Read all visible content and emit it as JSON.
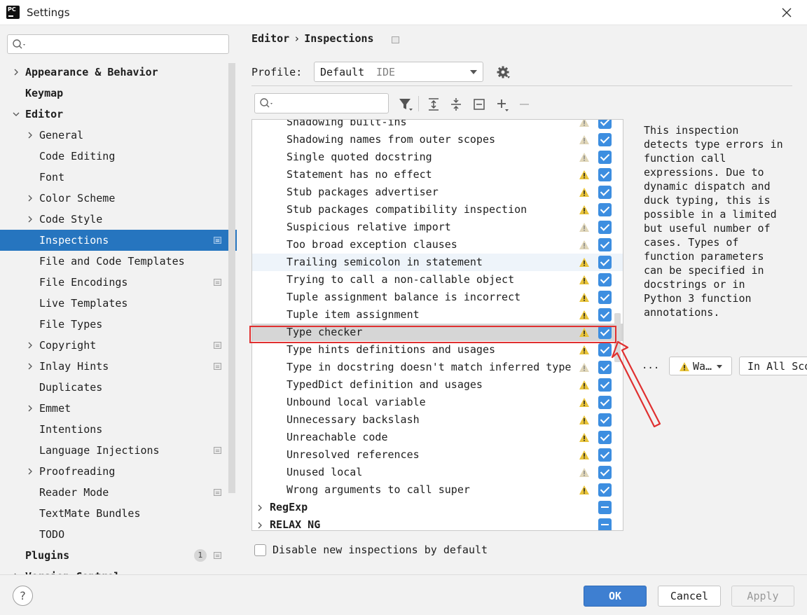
{
  "window": {
    "title": "Settings",
    "app_icon_text": "PC"
  },
  "search": {
    "placeholder": ""
  },
  "tree": [
    {
      "label": "Appearance & Behavior",
      "bold": true,
      "level": 0,
      "chevron": "right"
    },
    {
      "label": "Keymap",
      "bold": true,
      "level": 0,
      "chevron": "none"
    },
    {
      "label": "Editor",
      "bold": true,
      "level": 0,
      "chevron": "down"
    },
    {
      "label": "General",
      "level": 1,
      "chevron": "right"
    },
    {
      "label": "Code Editing",
      "level": 1,
      "chevron": "none"
    },
    {
      "label": "Font",
      "level": 1,
      "chevron": "none"
    },
    {
      "label": "Color Scheme",
      "level": 1,
      "chevron": "right"
    },
    {
      "label": "Code Style",
      "level": 1,
      "chevron": "right"
    },
    {
      "label": "Inspections",
      "level": 1,
      "chevron": "none",
      "selected": true,
      "badge": true
    },
    {
      "label": "File and Code Templates",
      "level": 1,
      "chevron": "none"
    },
    {
      "label": "File Encodings",
      "level": 1,
      "chevron": "none",
      "badge": true
    },
    {
      "label": "Live Templates",
      "level": 1,
      "chevron": "none"
    },
    {
      "label": "File Types",
      "level": 1,
      "chevron": "none"
    },
    {
      "label": "Copyright",
      "level": 1,
      "chevron": "right",
      "badge": true
    },
    {
      "label": "Inlay Hints",
      "level": 1,
      "chevron": "right",
      "badge": true
    },
    {
      "label": "Duplicates",
      "level": 1,
      "chevron": "none"
    },
    {
      "label": "Emmet",
      "level": 1,
      "chevron": "right"
    },
    {
      "label": "Intentions",
      "level": 1,
      "chevron": "none"
    },
    {
      "label": "Language Injections",
      "level": 1,
      "chevron": "none",
      "badge": true
    },
    {
      "label": "Proofreading",
      "level": 1,
      "chevron": "right"
    },
    {
      "label": "Reader Mode",
      "level": 1,
      "chevron": "none",
      "badge": true
    },
    {
      "label": "TextMate Bundles",
      "level": 1,
      "chevron": "none"
    },
    {
      "label": "TODO",
      "level": 1,
      "chevron": "none"
    },
    {
      "label": "Plugins",
      "bold": true,
      "level": 0,
      "chevron": "none",
      "count": "1",
      "badge": true
    },
    {
      "label": "Version Control",
      "bold": true,
      "level": 0,
      "chevron": "right"
    }
  ],
  "breadcrumb": {
    "parent": "Editor",
    "separator": "›",
    "current": "Inspections"
  },
  "profile": {
    "label": "Profile:",
    "value": "Default",
    "sub": "IDE"
  },
  "inspections": [
    {
      "label": "Shadowing built-ins",
      "warn": "weak"
    },
    {
      "label": "Shadowing names from outer scopes",
      "warn": "weak"
    },
    {
      "label": "Single quoted docstring",
      "warn": "weak"
    },
    {
      "label": "Statement has no effect",
      "warn": "strong"
    },
    {
      "label": "Stub packages advertiser",
      "warn": "strong"
    },
    {
      "label": "Stub packages compatibility inspection",
      "warn": "strong"
    },
    {
      "label": "Suspicious relative import",
      "warn": "weak"
    },
    {
      "label": "Too broad exception clauses",
      "warn": "weak"
    },
    {
      "label": "Trailing semicolon in statement",
      "warn": "strong",
      "hover": true
    },
    {
      "label": "Trying to call a non-callable object",
      "warn": "strong"
    },
    {
      "label": "Tuple assignment balance is incorrect",
      "warn": "strong"
    },
    {
      "label": "Tuple item assignment",
      "warn": "strong"
    },
    {
      "label": "Type checker",
      "warn": "strong",
      "selected": true
    },
    {
      "label": "Type hints definitions and usages",
      "warn": "strong"
    },
    {
      "label": "Type in docstring doesn't match inferred type",
      "warn": "weak"
    },
    {
      "label": "TypedDict definition and usages",
      "warn": "strong"
    },
    {
      "label": "Unbound local variable",
      "warn": "strong"
    },
    {
      "label": "Unnecessary backslash",
      "warn": "strong"
    },
    {
      "label": "Unreachable code",
      "warn": "strong"
    },
    {
      "label": "Unresolved references",
      "warn": "strong"
    },
    {
      "label": "Unused local",
      "warn": "weak"
    },
    {
      "label": "Wrong arguments to call super",
      "warn": "strong"
    }
  ],
  "groups": [
    {
      "label": "RegExp"
    },
    {
      "label": "RELAX NG"
    }
  ],
  "description": "This inspection\ndetects type errors in\nfunction call\nexpressions. Due to\ndynamic dispatch and\nduck typing, this is\npossible in a limited\nbut useful number of\ncases. Types of\nfunction parameters\ncan be specified in\ndocstrings or in\nPython 3 function\nannotations.",
  "severity": {
    "dots": "...",
    "value": "Wa…",
    "scope": "In All Scopes"
  },
  "disable_new": {
    "label": "Disable new inspections by default"
  },
  "buttons": {
    "help": "?",
    "ok": "OK",
    "cancel": "Cancel",
    "apply": "Apply"
  },
  "colors": {
    "accent": "#2675bf",
    "checkbox": "#3d8ee0",
    "warning": "#e8c33a",
    "highlight_frame": "#e03030"
  }
}
